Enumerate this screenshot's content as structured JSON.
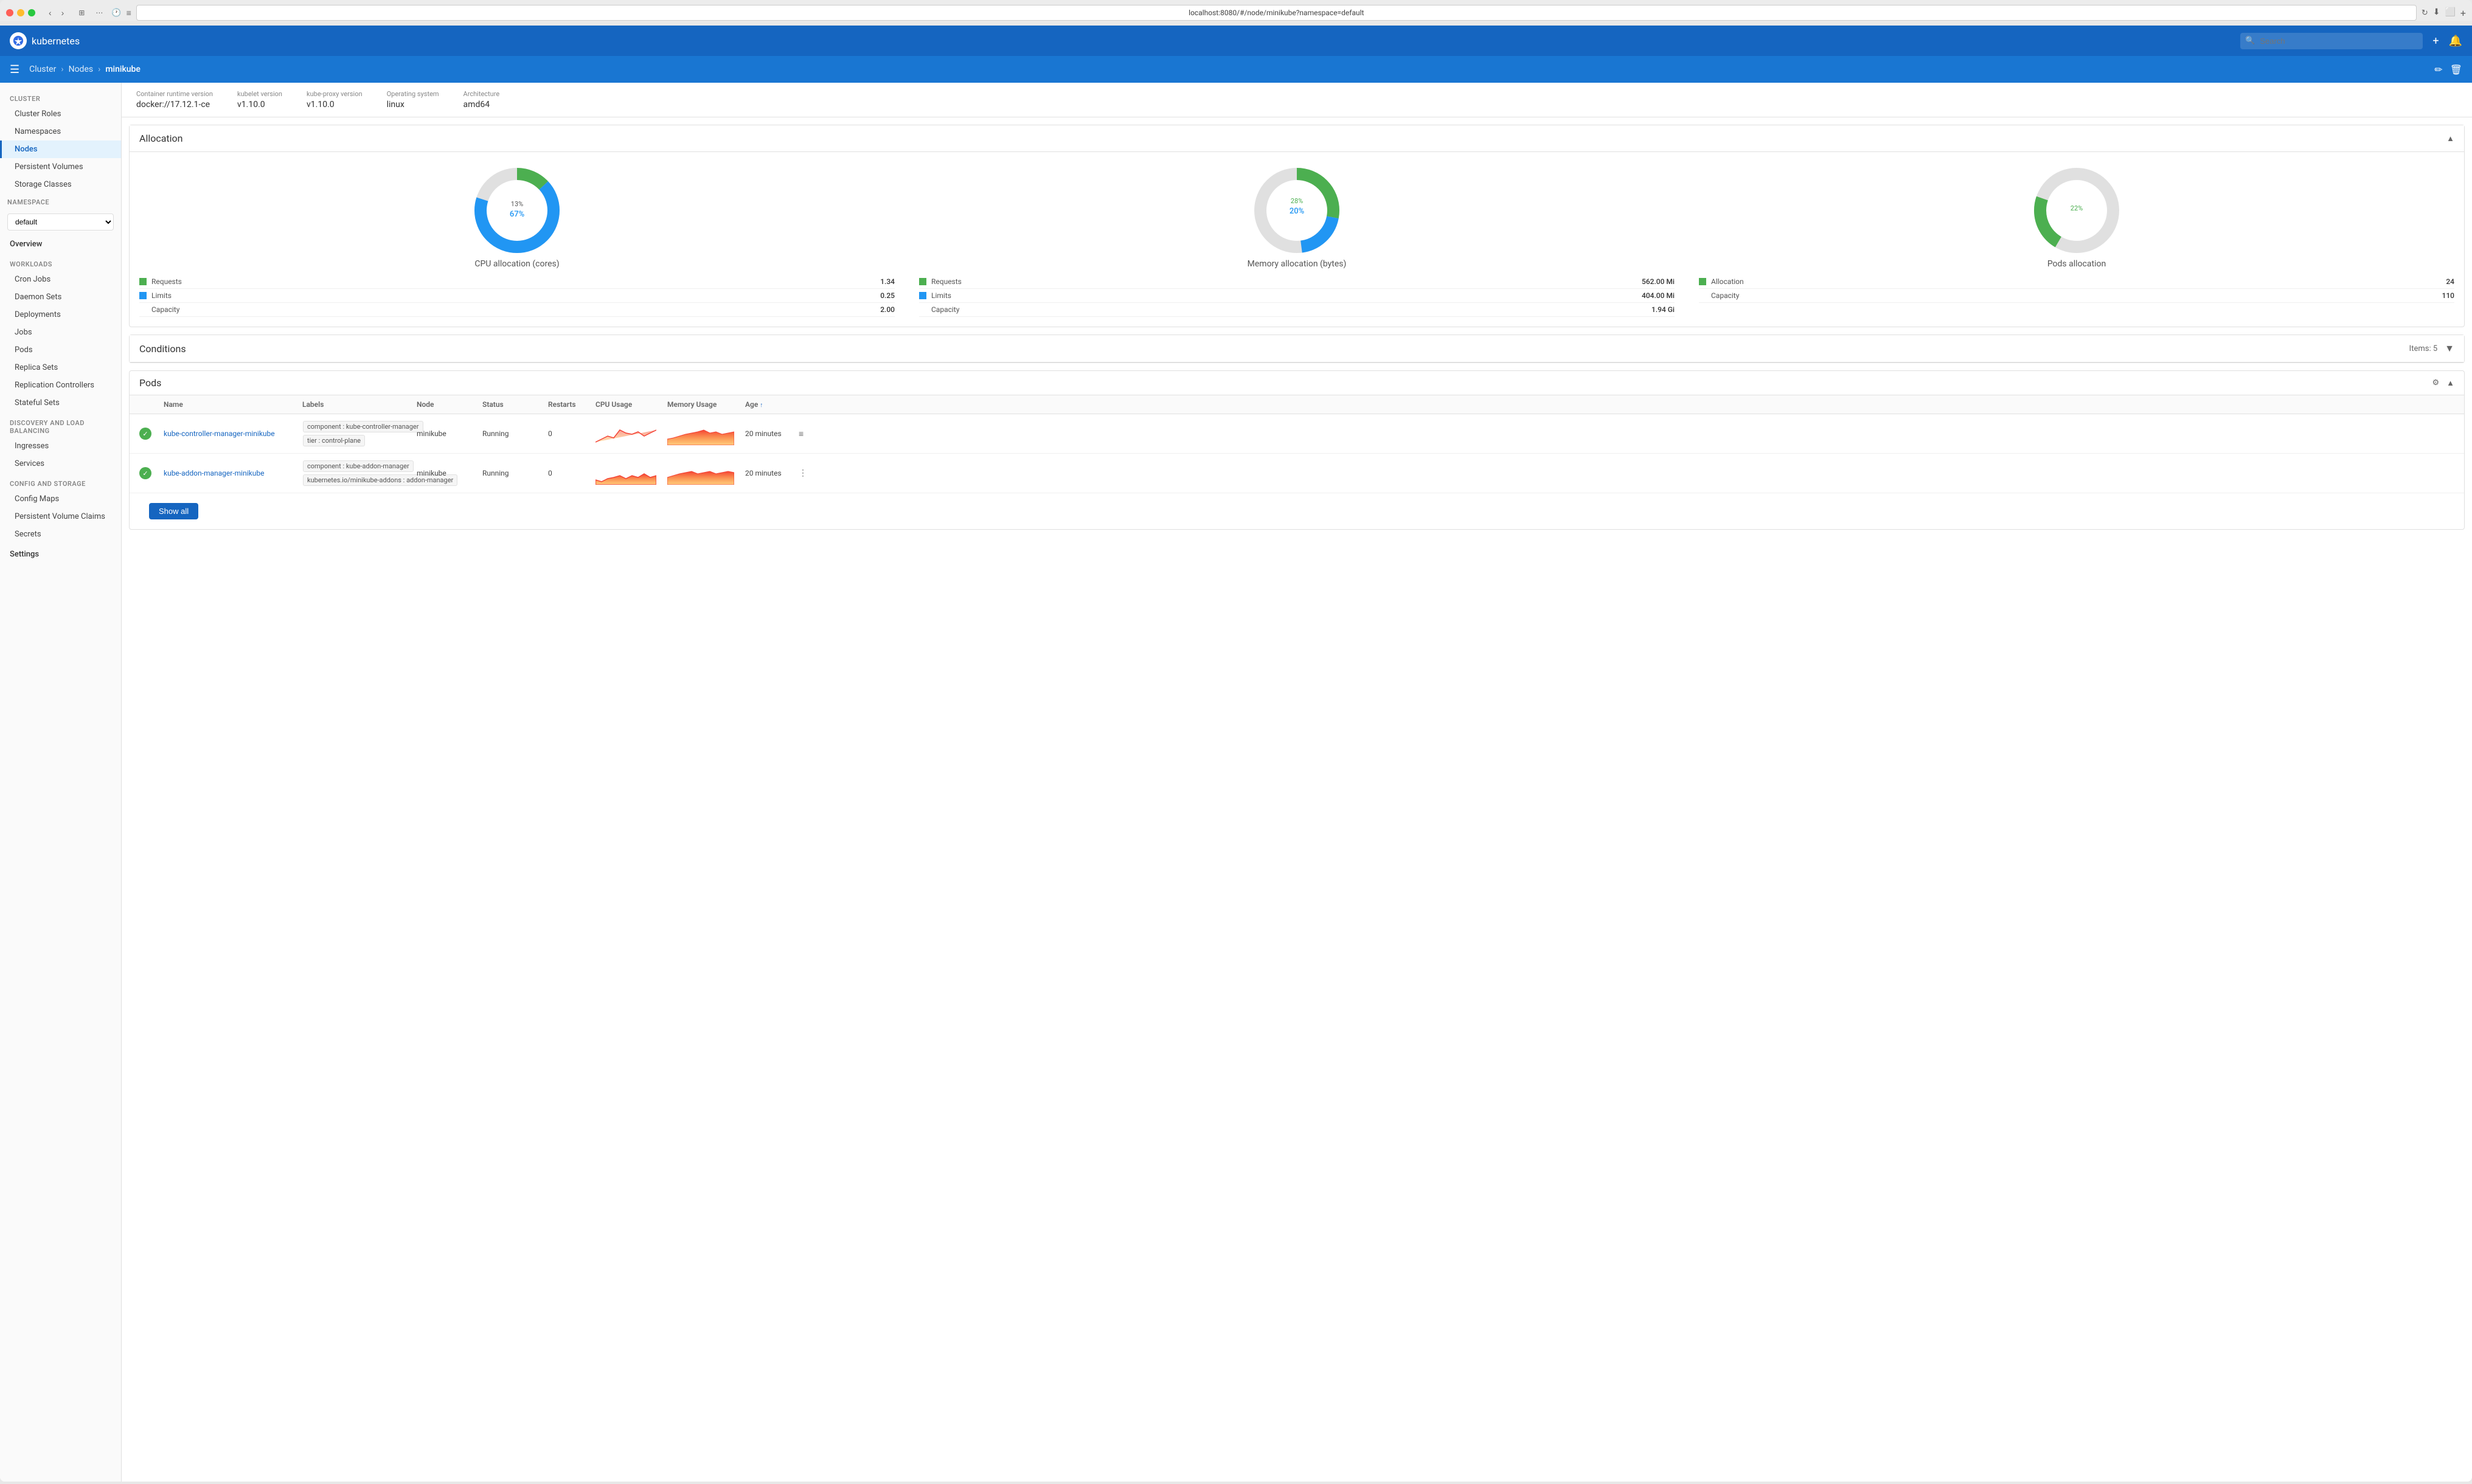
{
  "browser": {
    "url": "localhost:8080/#/node/minikube?namespace=default",
    "tab_label": "localhost:8080"
  },
  "topnav": {
    "logo_alt": "Kubernetes",
    "app_name": "kubernetes",
    "search_placeholder": "Search"
  },
  "breadcrumb": {
    "items": [
      "Cluster",
      "Nodes",
      "minikube"
    ],
    "edit_icon": "✏",
    "delete_icon": "🗑"
  },
  "sidebar": {
    "cluster_section": "Cluster",
    "cluster_items": [
      "Cluster Roles",
      "Namespaces",
      "Nodes",
      "Persistent Volumes",
      "Storage Classes"
    ],
    "namespace_label": "Namespace",
    "namespace_value": "default",
    "overview_label": "Overview",
    "workloads_section": "Workloads",
    "workloads_items": [
      "Cron Jobs",
      "Daemon Sets",
      "Deployments",
      "Jobs",
      "Pods",
      "Replica Sets",
      "Replication Controllers",
      "Stateful Sets"
    ],
    "discovery_section": "Discovery and Load Balancing",
    "discovery_items": [
      "Ingresses",
      "Services"
    ],
    "config_section": "Config and Storage",
    "config_items": [
      "Config Maps",
      "Persistent Volume Claims",
      "Secrets"
    ],
    "settings_label": "Settings"
  },
  "version_info": {
    "container_runtime_label": "Container runtime version",
    "container_runtime_value": "docker://17.12.1-ce",
    "kubelet_label": "kubelet version",
    "kubelet_value": "v1.10.0",
    "kube_proxy_label": "kube-proxy version",
    "kube_proxy_value": "v1.10.0",
    "os_label": "Operating system",
    "os_value": "linux",
    "arch_label": "Architecture",
    "arch_value": "amd64"
  },
  "allocation": {
    "title": "Allocation",
    "cpu_chart": {
      "title": "CPU allocation (cores)",
      "green_pct": 13,
      "blue_pct": 67,
      "gray_pct": 20,
      "green_label": "13%",
      "blue_label": "67%",
      "legend": [
        {
          "color": "#4caf50",
          "label": "Requests",
          "value": "1.34"
        },
        {
          "color": "#2196f3",
          "label": "Limits",
          "value": "0.25"
        },
        {
          "color": "",
          "label": "Capacity",
          "value": "2.00"
        }
      ]
    },
    "memory_chart": {
      "title": "Memory allocation (bytes)",
      "green_pct": 28,
      "blue_pct": 20,
      "gray_pct": 52,
      "green_label": "28%",
      "blue_label": "20%",
      "legend": [
        {
          "color": "#4caf50",
          "label": "Requests",
          "value": "562.00 Mi"
        },
        {
          "color": "#2196f3",
          "label": "Limits",
          "value": "404.00 Mi"
        },
        {
          "color": "",
          "label": "Capacity",
          "value": "1.94 Gi"
        }
      ]
    },
    "pods_chart": {
      "title": "Pods allocation",
      "green_pct": 22,
      "gray_pct": 78,
      "green_label": "22%",
      "legend": [
        {
          "color": "#4caf50",
          "label": "Allocation",
          "value": "24"
        },
        {
          "color": "",
          "label": "Capacity",
          "value": "110"
        }
      ]
    }
  },
  "conditions": {
    "title": "Conditions",
    "items_label": "Items: 5"
  },
  "pods": {
    "title": "Pods",
    "columns": [
      "Name",
      "Labels",
      "Node",
      "Status",
      "Restarts",
      "CPU Usage",
      "Memory Usage",
      "Age"
    ],
    "age_sort": "↑",
    "rows": [
      {
        "status_ok": true,
        "name": "kube-controller-manager-minikube",
        "labels": [
          "component : kube-controller-manager",
          "tier : control-plane"
        ],
        "node": "minikube",
        "status": "Running",
        "restarts": "0",
        "age": "20 minutes"
      },
      {
        "status_ok": true,
        "name": "kube-addon-manager-minikube",
        "labels": [
          "component : kube-addon-manager",
          "kubernetes.io/minikube-addons : addon-manager"
        ],
        "node": "minikube",
        "status": "Running",
        "restarts": "0",
        "age": "20 minutes"
      }
    ],
    "show_all_label": "Show all"
  }
}
